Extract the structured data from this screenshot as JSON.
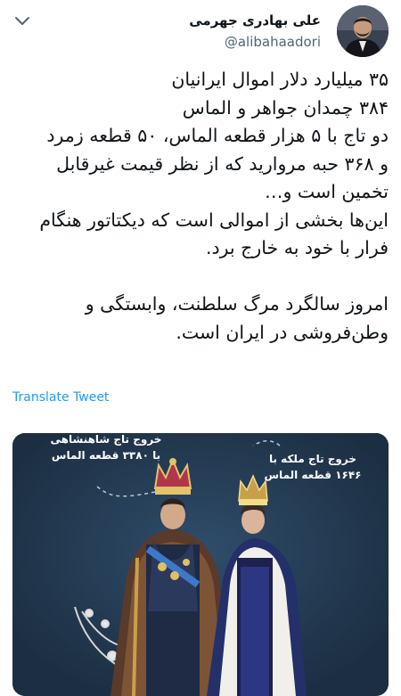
{
  "author": {
    "display_name": "علی بهادری جهرمی",
    "handle": "@alibahaadori"
  },
  "tweet": {
    "lines": [
      "۳۵ میلیارد دلار اموال ایرانیان",
      "۳۸۴ چمدان جواهر و الماس",
      "دو تاج با ۵ هزار قطعه الماس، ۵۰ قطعه زمرد",
      "و ۳۶۸ حبه مروارید که از نظر قیمت غیرقابل",
      "تخمین است و…",
      "این‌ها بخشی از اموالی است که دیکتاتور هنگام",
      "فرار با خود به خارج برد."
    ],
    "closing_lines": [
      "امروز سالگرد مرگ سلطنت، وابستگی و",
      "وطن‌فروشی در ایران است."
    ]
  },
  "translate_label": "Translate Tweet",
  "image": {
    "caption_left_line1": "خروج تاج شاهنشاهی",
    "caption_left_line2": "با ۳۳۸۰ قطعه الماس",
    "caption_right_line1": "خروج تاج ملکه با",
    "caption_right_line2": "۱۶۴۶ قطعه الماس"
  },
  "colors": {
    "link": "#1d9bf0",
    "media_background": "#203449",
    "text": "#0f1419",
    "secondary_text": "#536471"
  },
  "icons": {
    "menu": "chevron-down-icon"
  }
}
